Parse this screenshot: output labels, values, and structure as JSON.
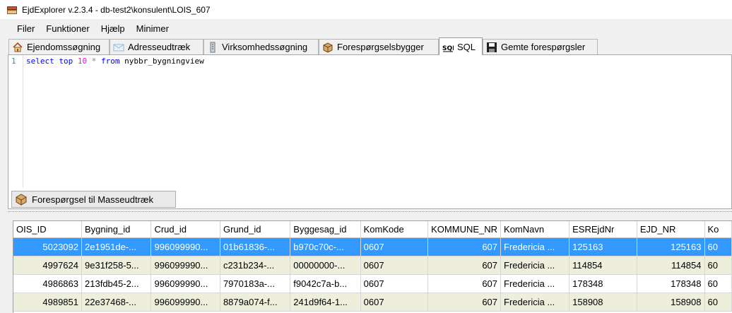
{
  "window": {
    "title": "EjdExplorer v.2.3.4 - db-test2\\konsulent\\LOIS_607"
  },
  "menu": [
    "Filer",
    "Funktioner",
    "Hjælp",
    "Minimer"
  ],
  "tabs": [
    {
      "label": "Ejendomssøgning",
      "icon": "house-icon"
    },
    {
      "label": "Adresseudtræk",
      "icon": "envelope-icon"
    },
    {
      "label": "Virksomhedssøgning",
      "icon": "building-icon"
    },
    {
      "label": "Forespørgselsbygger",
      "icon": "box-icon"
    },
    {
      "label": "SQL",
      "icon": "sql-icon"
    },
    {
      "label": "Gemte forespørgsler",
      "icon": "floppy-icon"
    }
  ],
  "active_tab": "SQL",
  "editor": {
    "line_number": "1",
    "tokens": {
      "select": "select",
      "top": "top",
      "num": "10",
      "star": "*",
      "from": "from",
      "table": "nybbr_bygningview"
    }
  },
  "mass_button": {
    "label": "Forespørgsel til Masseudtræk",
    "icon": "box-icon"
  },
  "grid": {
    "columns": [
      "OIS_ID",
      "Bygning_id",
      "Crud_id",
      "Grund_id",
      "Byggesag_id",
      "KomKode",
      "KOMMUNE_NR",
      "KomNavn",
      "ESREjdNr",
      "EJD_NR",
      "Ko"
    ],
    "rows": [
      [
        "5023092",
        "2e1951de-...",
        "996099990...",
        "01b61836-...",
        "b970c70c-...",
        "0607",
        "607",
        "Fredericia ...",
        "125163",
        "125163",
        "60"
      ],
      [
        "4997624",
        "9e31f258-5...",
        "996099990...",
        "c231b234-...",
        "00000000-...",
        "0607",
        "607",
        "Fredericia ...",
        "114854",
        "114854",
        "60"
      ],
      [
        "4986863",
        "213fdb45-2...",
        "996099990...",
        "7970183a-...",
        "f9042c7a-b...",
        "0607",
        "607",
        "Fredericia ...",
        "178348",
        "178348",
        "60"
      ],
      [
        "4989851",
        "22e37468-...",
        "996099990...",
        "8879a074-f...",
        "241d9f64-1...",
        "0607",
        "607",
        "Fredericia ...",
        "158908",
        "158908",
        "60"
      ]
    ]
  },
  "colors": {
    "selection": "#3399ff",
    "alt_row": "#eeeedd",
    "keyword": "#0000ff",
    "number": "#ff00ff"
  }
}
